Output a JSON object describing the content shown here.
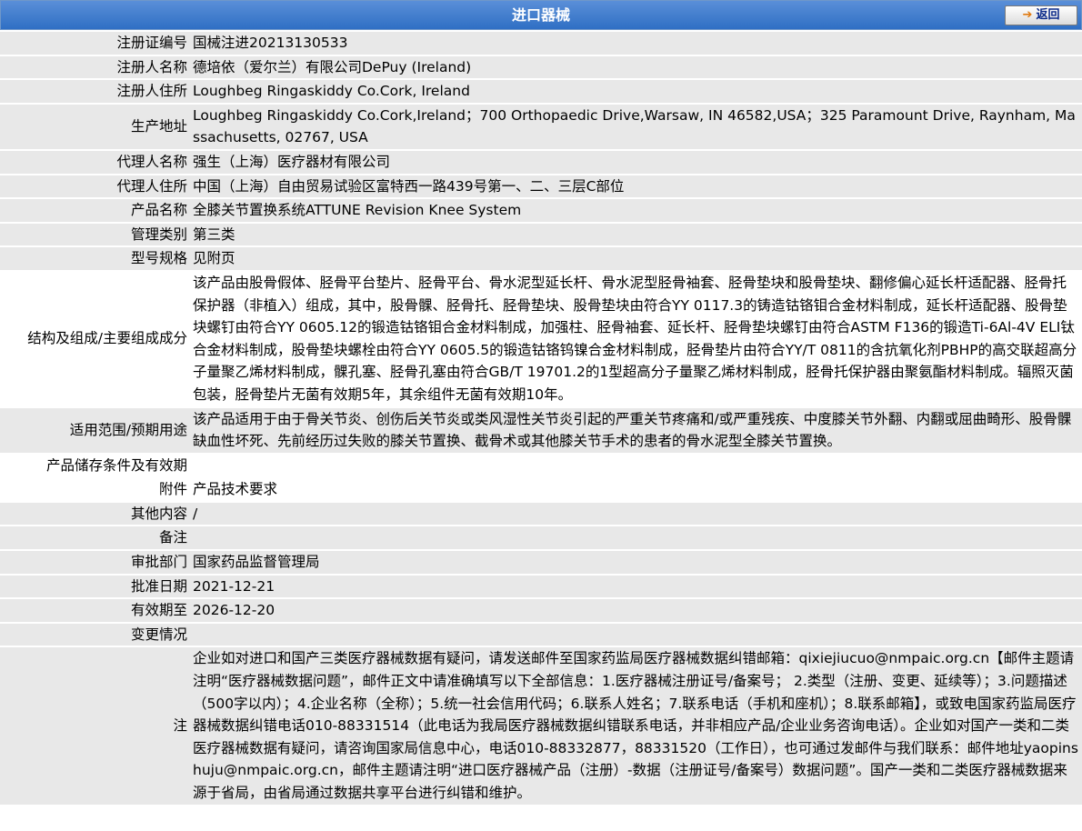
{
  "header": {
    "title": "进口器械",
    "back_label": "返回",
    "back_icon": "➔"
  },
  "fields": [
    {
      "label": "注册证编号",
      "value": "国械注进20213130533"
    },
    {
      "label": "注册人名称",
      "value": "德培依（爱尔兰）有限公司DePuy (Ireland)"
    },
    {
      "label": "注册人住所",
      "value": "Loughbeg Ringaskiddy Co.Cork, Ireland"
    },
    {
      "label": "生产地址",
      "value": "Loughbeg Ringaskiddy Co.Cork,Ireland；700 Orthopaedic Drive,Warsaw, IN 46582,USA；325 Paramount Drive, Raynham, Massachusetts, 02767, USA"
    },
    {
      "label": "代理人名称",
      "value": "强生（上海）医疗器材有限公司"
    },
    {
      "label": "代理人住所",
      "value": "中国（上海）自由贸易试验区富特西一路439号第一、二、三层C部位"
    },
    {
      "label": "产品名称",
      "value": "全膝关节置换系统ATTUNE Revision Knee System"
    },
    {
      "label": "管理类别",
      "value": "第三类"
    },
    {
      "label": "型号规格",
      "value": "见附页"
    },
    {
      "label": "结构及组成/主要组成成分",
      "value": "该产品由股骨假体、胫骨平台垫片、胫骨平台、骨水泥型延长杆、骨水泥型胫骨袖套、胫骨垫块和股骨垫块、翻修偏心延长杆适配器、胫骨托保护器（非植入）组成，其中，股骨髁、胫骨托、胫骨垫块、股骨垫块由符合YY 0117.3的铸造钴铬钼合金材料制成，延长杆适配器、股骨垫块螺钉由符合YY 0605.12的锻造钴铬钼合金材料制成，加强柱、胫骨袖套、延长杆、胫骨垫块螺钉由符合ASTM F136的锻造Ti-6Al-4V ELI钛合金材料制成，股骨垫块螺栓由符合YY 0605.5的锻造钴铬钨镍合金材料制成，胫骨垫片由符合YY/T 0811的含抗氧化剂PBHP的高交联超高分子量聚乙烯材料制成，髁孔塞、胫骨孔塞由符合GB/T 19701.2的1型超高分子量聚乙烯材料制成，胫骨托保护器由聚氨酯材料制成。辐照灭菌包装，胫骨垫片无菌有效期5年，其余组件无菌有效期10年。"
    },
    {
      "label": "适用范围/预期用途",
      "value": "该产品适用于由于骨关节炎、创伤后关节炎或类风湿性关节炎引起的严重关节疼痛和/或严重残疾、中度膝关节外翻、内翻或屈曲畸形、股骨髁缺血性坏死、先前经历过失败的膝关节置换、截骨术或其他膝关节手术的患者的骨水泥型全膝关节置换。"
    },
    {
      "label": "产品储存条件及有效期",
      "value": ""
    },
    {
      "label": "附件",
      "value": "产品技术要求"
    },
    {
      "label": "其他内容",
      "value": "/"
    },
    {
      "label": "备注",
      "value": ""
    },
    {
      "label": "审批部门",
      "value": "国家药品监督管理局"
    },
    {
      "label": "批准日期",
      "value": "2021-12-21"
    },
    {
      "label": "有效期至",
      "value": "2026-12-20"
    },
    {
      "label": "变更情况",
      "value": ""
    }
  ],
  "note": {
    "label": "注",
    "value": "企业如对进口和国产三类医疗器械数据有疑问，请发送邮件至国家药监局医疗器械数据纠错邮箱：qixiejiucuo@nmpaic.org.cn【邮件主题请注明“医疗器械数据问题”，邮件正文中请准确填写以下全部信息：1.医疗器械注册证号/备案号； 2.类型（注册、变更、延续等）；3.问题描述（500字以内）；4.企业名称（全称）；5.统一社会信用代码；6.联系人姓名；7.联系电话（手机和座机）；8.联系邮箱】，或致电国家药监局医疗器械数据纠错电话010-88331514（此电话为我局医疗器械数据纠错联系电话，并非相应产品/企业业务咨询电话）。企业如对国产一类和二类医疗器械数据有疑问，请咨询国家局信息中心，电话010-88332877，88331520（工作日），也可通过发邮件与我们联系：邮件地址yaopinshuju@nmpaic.org.cn，邮件主题请注明“进口医疗器械产品（注册）-数据（注册证号/备案号）数据问题”。国产一类和二类医疗器械数据来源于省局，由省局通过数据共享平台进行纠错和维护。"
  }
}
